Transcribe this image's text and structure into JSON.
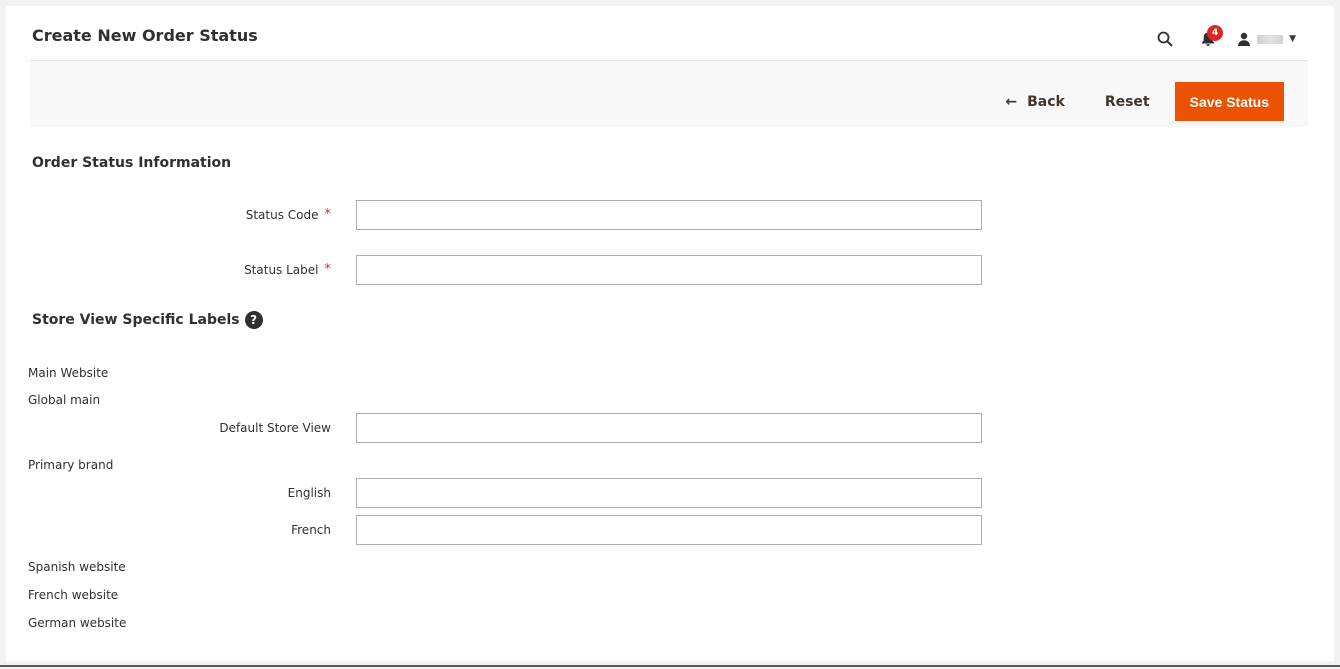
{
  "header": {
    "title": "Create New Order Status",
    "notifications_count": "4"
  },
  "actions": {
    "back_label": "Back",
    "back_arrow": "←",
    "reset_label": "Reset",
    "save_label": "Save Status"
  },
  "order_status_info": {
    "section_title": "Order Status Information",
    "status_code_label": "Status Code",
    "status_code_value": "",
    "status_label_label": "Status Label",
    "status_label_value": "",
    "required_mark": "*"
  },
  "store_labels": {
    "section_title": "Store View Specific Labels",
    "help_glyph": "?",
    "main_website": "Main Website",
    "global_main": "Global main",
    "default_store_view": "Default Store View",
    "primary_brand": "Primary brand",
    "english": "English",
    "french": "French",
    "spanish_website": "Spanish website",
    "french_website": "French website",
    "german_website": "German website"
  },
  "colors": {
    "accent": "#eb5202",
    "badge": "#e22626",
    "required": "#e22626"
  },
  "icons": {
    "search": "search-icon",
    "notifications": "bell-icon",
    "user": "user-icon",
    "dropdown": "caret-down-icon",
    "help": "question-circle-icon"
  }
}
